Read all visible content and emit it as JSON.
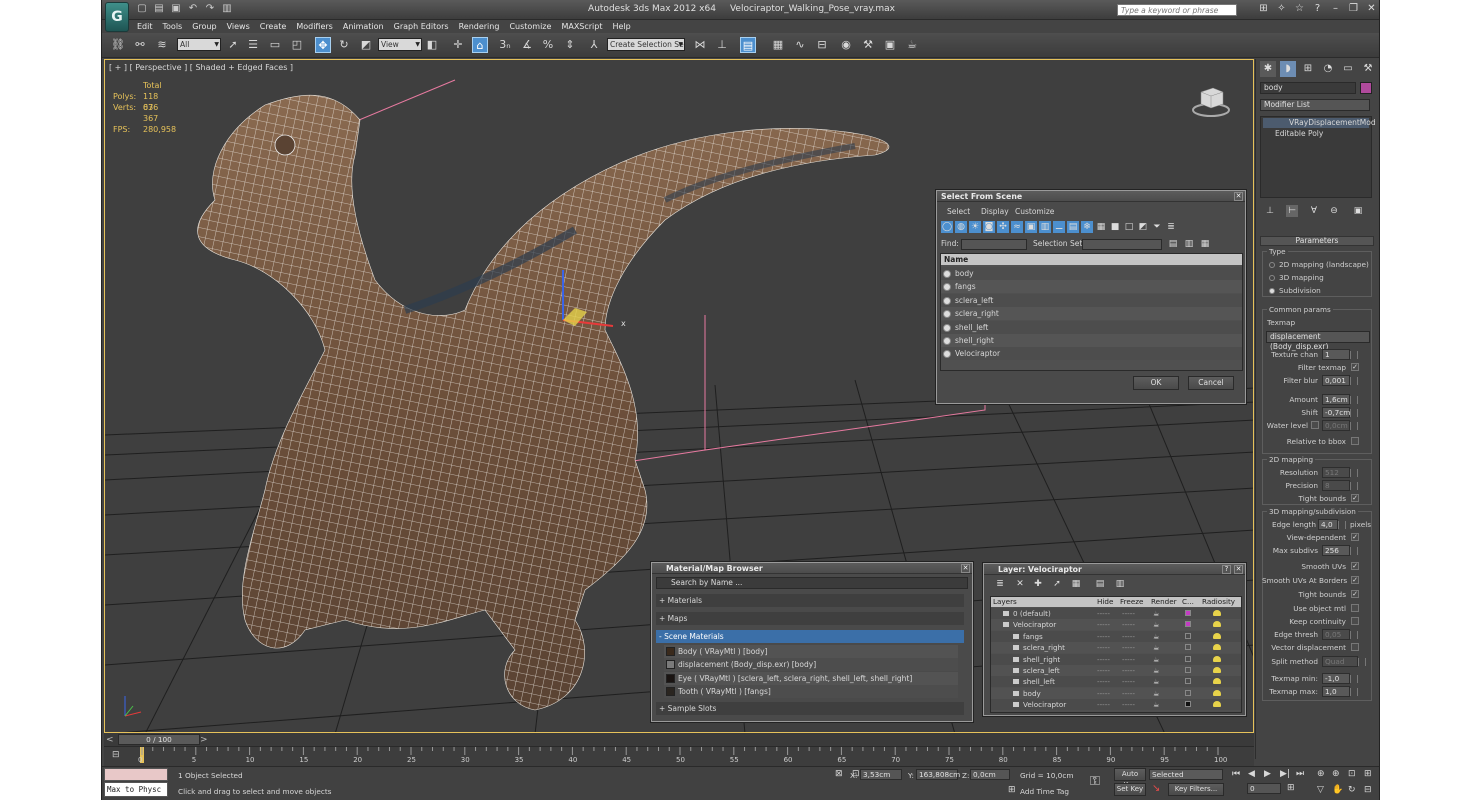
{
  "window": {
    "app_title": "Autodesk 3ds Max  2012 x64",
    "file_title": "Velociraptor_Walking_Pose_vray.max",
    "search_placeholder": "Type a keyword or phrase",
    "logo_glyph": "G"
  },
  "menu": [
    "Edit",
    "Tools",
    "Group",
    "Views",
    "Create",
    "Modifiers",
    "Animation",
    "Graph Editors",
    "Rendering",
    "Customize",
    "MAXScript",
    "Help"
  ],
  "toolbar": {
    "filter_value": "All",
    "refcoord_value": "View",
    "selection_set_placeholder": "Create Selection Se"
  },
  "viewport": {
    "label": "[ + ] [ Perspective ] [ Shaded + Edged Faces ]",
    "stats": {
      "total_label": "Total",
      "polys_label": "Polys:",
      "polys_value": "118 076",
      "verts_label": "Verts:",
      "verts_value": "63 367",
      "fps_label": "FPS:",
      "fps_value": "280,958"
    },
    "gizmo_x": "x"
  },
  "select_from_scene": {
    "title": "Select From Scene",
    "menus": [
      "Select",
      "Display",
      "Customize"
    ],
    "find_label": "Find:",
    "selection_set_label": "Selection Set:",
    "column_name": "Name",
    "items": [
      "body",
      "fangs",
      "sclera_left",
      "sclera_right",
      "shell_left",
      "shell_right",
      "Velociraptor"
    ],
    "ok": "OK",
    "cancel": "Cancel"
  },
  "material_browser": {
    "title": "Material/Map Browser",
    "search_placeholder": "Search by Name ...",
    "sections": {
      "materials": "+ Materials",
      "maps": "+ Maps",
      "scene": "- Scene Materials",
      "sample": "+ Sample Slots"
    },
    "scene_items": [
      "Body  ( VRayMtl )  [body]",
      "displacement (Body_disp.exr) [body]",
      "Eye  ( VRayMtl )  [sclera_left, sclera_right, shell_left, shell_right]",
      "Tooth  ( VRayMtl )  [fangs]"
    ]
  },
  "layer_dialog": {
    "title": "Layer: Velociraptor",
    "columns": [
      "Layers",
      "Hide",
      "Freeze",
      "Render",
      "C...",
      "Radiosity"
    ],
    "rows": [
      {
        "name": "0 (default)",
        "indent": 0,
        "color": "#c43cc4"
      },
      {
        "name": "Velociraptor",
        "indent": 0,
        "color": "#c43cc4"
      },
      {
        "name": "fangs",
        "indent": 1,
        "color": ""
      },
      {
        "name": "sclera_right",
        "indent": 1,
        "color": ""
      },
      {
        "name": "shell_right",
        "indent": 1,
        "color": ""
      },
      {
        "name": "sclera_left",
        "indent": 1,
        "color": ""
      },
      {
        "name": "shell_left",
        "indent": 1,
        "color": ""
      },
      {
        "name": "body",
        "indent": 1,
        "color": ""
      },
      {
        "name": "Velociraptor",
        "indent": 1,
        "color": "#111111"
      }
    ],
    "dash": "-----",
    "help": "?"
  },
  "command_panel": {
    "name_field": "body",
    "modifier_list": "Modifier List",
    "stack": [
      "VRayDisplacementMod",
      "Editable Poly"
    ],
    "parameters_title": "Parameters",
    "type_label": "Type",
    "type_options": [
      "2D mapping (landscape)",
      "3D mapping",
      "Subdivision"
    ],
    "common_params": "Common params",
    "texmap_label": "Texmap",
    "texmap_value": "displacement (Body_disp.exr)",
    "texture_chan_label": "Texture chan",
    "texture_chan_value": "1",
    "filter_texmap_label": "Filter texmap",
    "filter_blur_label": "Filter blur",
    "filter_blur_value": "0,001",
    "amount_label": "Amount",
    "amount_value": "1,6cm",
    "shift_label": "Shift",
    "shift_value": "-0,7cm",
    "water_level_label": "Water level",
    "water_level_value": "0,0cm",
    "relative_bbox_label": "Relative to bbox",
    "mapping2d_title": "2D mapping",
    "resolution_label": "Resolution",
    "resolution_value": "512",
    "precision_label": "Precision",
    "precision_value": "8",
    "tight_bounds_label": "Tight bounds",
    "mapping3d_title": "3D mapping/subdivision",
    "edge_length_label": "Edge length",
    "edge_length_value": "4,0",
    "pixels_label": "pixels",
    "view_dependent_label": "View-dependent",
    "max_subdivs_label": "Max subdivs",
    "max_subdivs_value": "256",
    "smooth_uvs_label": "Smooth UVs",
    "smooth_uvs_borders_label": "Smooth UVs At Borders",
    "tight_bounds2_label": "Tight bounds",
    "use_object_mtl_label": "Use object mtl",
    "keep_continuity_label": "Keep continuity",
    "edge_thresh_label": "Edge thresh",
    "edge_thresh_value": "0,05",
    "vector_disp_label": "Vector displacement",
    "split_method_label": "Split method",
    "split_method_value": "Quad",
    "texmap_min_label": "Texmap min:",
    "texmap_min_value": "-1,0",
    "texmap_max_label": "Texmap max:",
    "texmap_max_value": "1,0"
  },
  "timeline": {
    "slider_label": "0 / 100",
    "ticks": [
      "0",
      "5",
      "10",
      "15",
      "20",
      "25",
      "30",
      "35",
      "40",
      "45",
      "50",
      "55",
      "60",
      "65",
      "70",
      "75",
      "80",
      "85",
      "90",
      "95",
      "100"
    ]
  },
  "status": {
    "script_label": "Max to Physc",
    "selected_text": "1 Object Selected",
    "hint_text": "Click and drag to select and move objects",
    "x_label": "X:",
    "x_value": "3,53cm",
    "y_label": "Y:",
    "y_value": "163,808cm",
    "z_label": "Z:",
    "z_value": "0,0cm",
    "grid_text": "Grid = 10,0cm",
    "add_time_tag": "Add Time Tag",
    "auto_key": "Auto Key",
    "set_key": "Set Key",
    "key_mode_value": "Selected",
    "key_filters": "Key Filters...",
    "frame_value": "0"
  }
}
